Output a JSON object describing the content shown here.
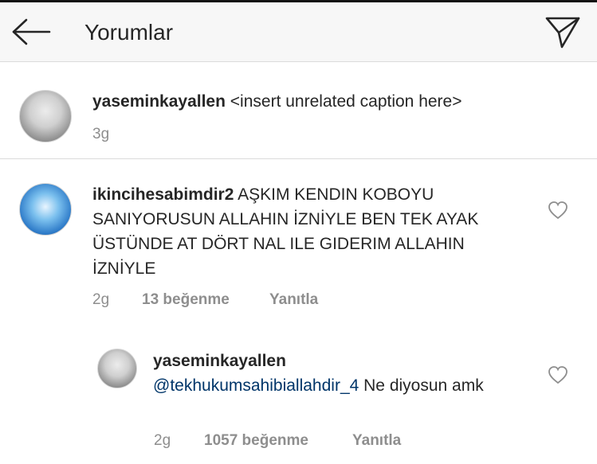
{
  "header": {
    "title": "Yorumlar"
  },
  "caption": {
    "username": "yaseminkayallen",
    "text": "<insert unrelated caption here>",
    "time": "3g"
  },
  "comments": [
    {
      "username": "ikincihesabimdir2",
      "text": "AŞKIM KENDIN KOBOYU SANIYORUSUN ALLAHIN İZNİYLE BEN TEK AYAK ÜSTÜNDE AT DÖRT NAL ILE GIDERIM ALLAHIN İZNİYLE",
      "time": "2g",
      "likes": "13 beğenme",
      "reply_label": "Yanıtla"
    }
  ],
  "replies": [
    {
      "username": "yaseminkayallen",
      "mention": "@tekhukumsahibiallahdir_4",
      "text": "Ne diyosun amk",
      "time": "2g",
      "likes": "1057 beğenme",
      "reply_label": "Yanıtla"
    }
  ],
  "icons": {
    "back": "arrow-left-icon",
    "send": "paper-plane-icon",
    "like": "heart-outline-icon"
  }
}
